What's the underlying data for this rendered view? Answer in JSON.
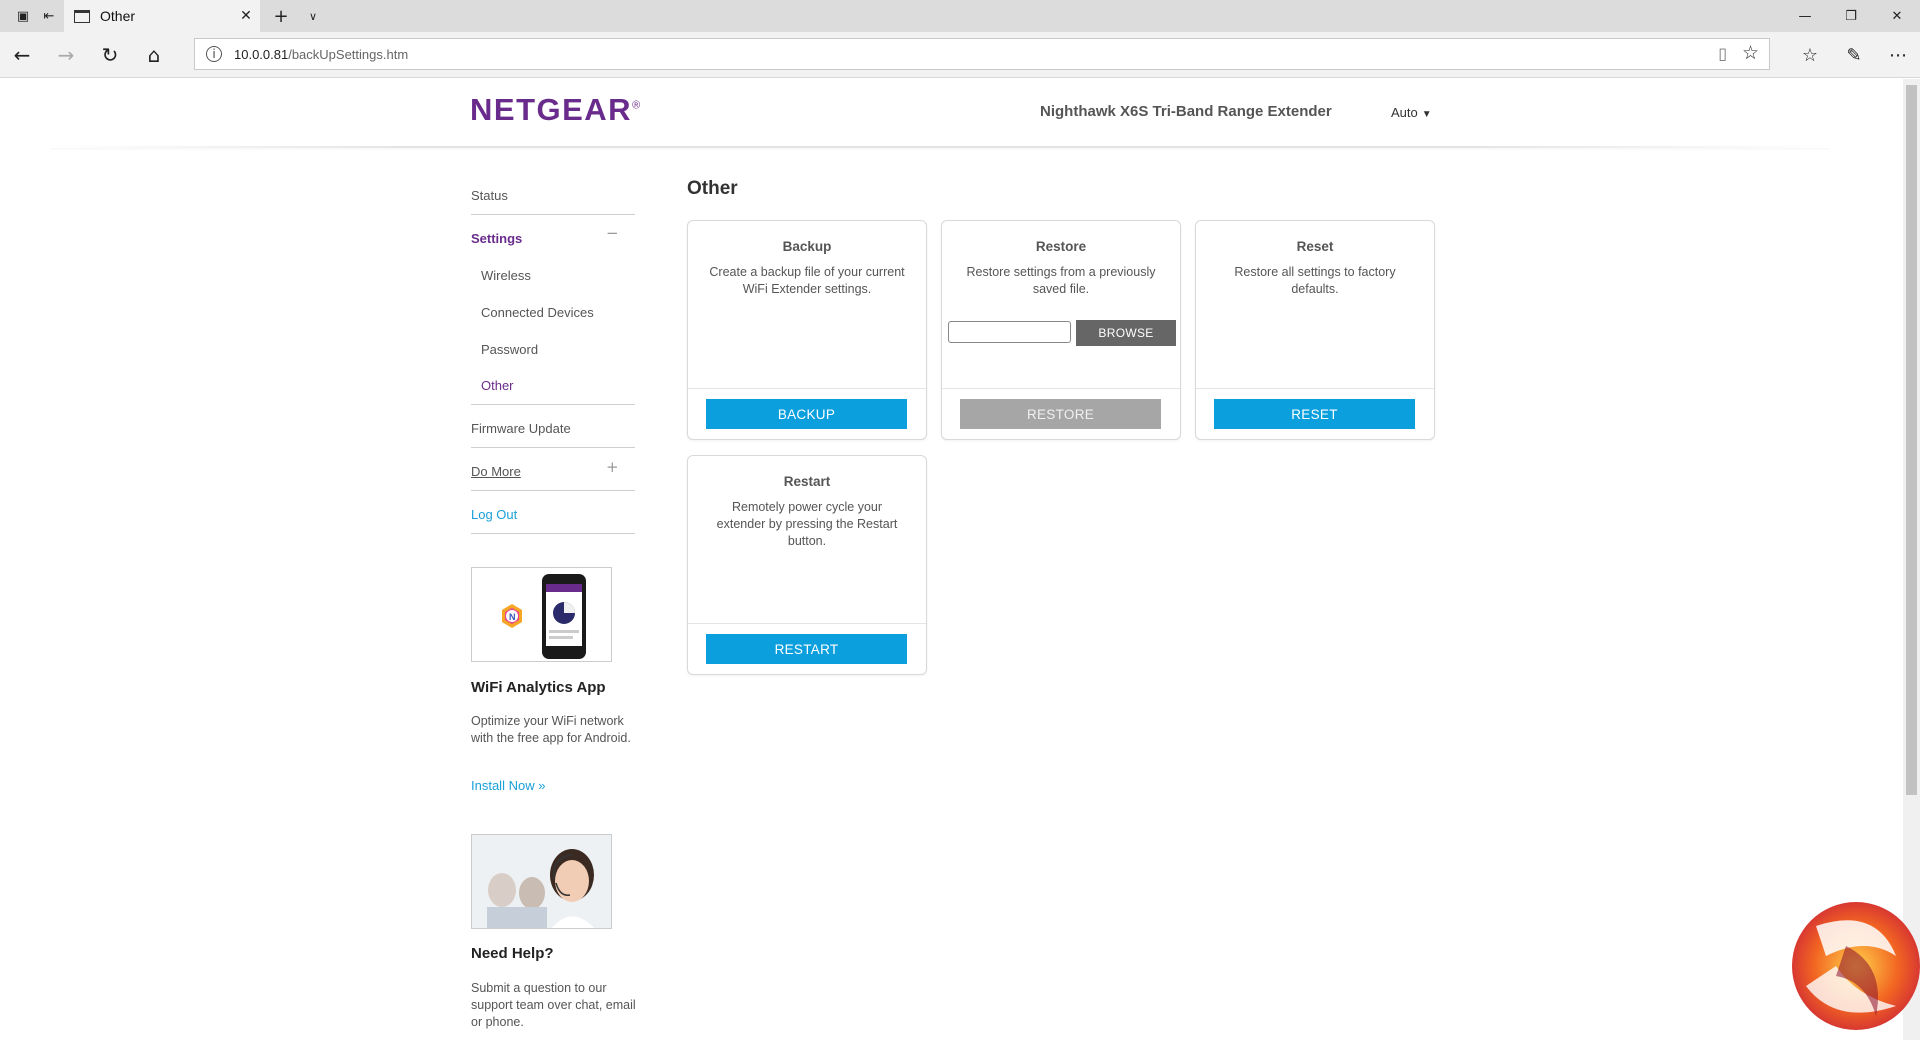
{
  "browser": {
    "tab_title": "Other",
    "url_host": "10.0.0.81",
    "url_path": "/backUpSettings.htm"
  },
  "header": {
    "logo": "NETGEAR",
    "logo_registered": "®",
    "product_name": "Nighthawk X6S Tri-Band Range Extender",
    "language": "Auto"
  },
  "sidebar": {
    "status": "Status",
    "settings": "Settings",
    "settings_toggle": "−",
    "sub_items": [
      "Wireless",
      "Connected Devices",
      "Password",
      "Other"
    ],
    "active_sub_item": "Other",
    "firmware_update": "Firmware Update",
    "do_more": "Do More",
    "do_more_toggle": "+",
    "log_out": "Log Out"
  },
  "promos": {
    "app": {
      "title": "WiFi Analytics App",
      "text": "Optimize your WiFi network with the free app for Android.",
      "link": "Install Now »"
    },
    "help": {
      "title": "Need Help?",
      "text": "Submit a question to our support team over chat, email or phone."
    }
  },
  "main": {
    "title": "Other",
    "cards": {
      "backup": {
        "title": "Backup",
        "description": "Create a backup file of your current WiFi Extender settings.",
        "button": "BACKUP"
      },
      "restore": {
        "title": "Restore",
        "description": "Restore settings from a previously saved file.",
        "file_value": "",
        "browse_button": "BROWSE",
        "button": "RESTORE"
      },
      "reset": {
        "title": "Reset",
        "description": "Restore all settings to factory defaults.",
        "button": "RESET"
      },
      "restart": {
        "title": "Restart",
        "description": "Remotely power cycle your extender by pressing the Restart button.",
        "button": "RESTART"
      }
    }
  },
  "colors": {
    "brand_purple": "#6a2c8c",
    "action_blue": "#0b9fde",
    "disabled_gray": "#a6a6a6",
    "link_blue": "#1aa0d8"
  }
}
